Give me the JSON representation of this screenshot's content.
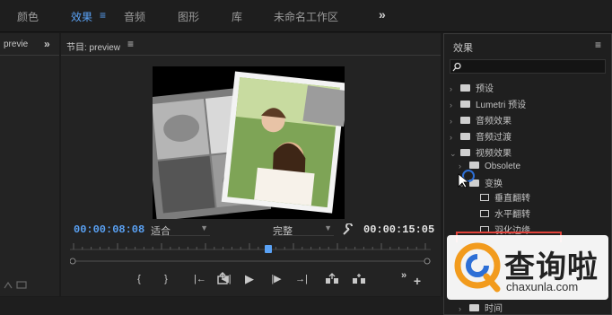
{
  "workspace": {
    "tabs": [
      {
        "label": "颜色"
      },
      {
        "label": "效果"
      },
      {
        "label": "音频"
      },
      {
        "label": "图形"
      },
      {
        "label": "库"
      },
      {
        "label": "未命名工作区"
      }
    ],
    "more": "»",
    "menu": "≡"
  },
  "left_panel": {
    "title": "previe",
    "more": "»"
  },
  "program": {
    "title": "节目: preview",
    "menu": "≡",
    "timecode_current": "00:00:08:08",
    "timecode_duration": "00:00:15:05",
    "fit_value": "适合",
    "quality_value": "完整",
    "playhead_fraction": 0.55
  },
  "transport": {
    "mark_in": "{",
    "mark_out": "}",
    "goto_in": "|←",
    "step_back": "◀|",
    "play": "▶",
    "step_fwd": "|▶",
    "goto_out": "→|",
    "more": "»",
    "add": "+"
  },
  "effects": {
    "title": "效果",
    "menu": "≡",
    "items": [
      {
        "label": "预设"
      },
      {
        "label": "Lumetri 预设"
      },
      {
        "label": "音频效果"
      },
      {
        "label": "音频过渡"
      },
      {
        "label": "视频效果"
      },
      {
        "label": "Obsolete"
      },
      {
        "label": "变换"
      },
      {
        "label": "垂直翻转"
      },
      {
        "label": "水平翻转"
      },
      {
        "label": "羽化边缘"
      },
      {
        "label": "时间"
      }
    ]
  },
  "watermark": {
    "brand": "查询啦",
    "url": "chaxunla.com"
  },
  "colors": {
    "accent": "#5aa2f5",
    "highlight_box": "#e0413a",
    "watermark_orange": "#f29b1d",
    "watermark_blue": "#2d6fd6"
  }
}
